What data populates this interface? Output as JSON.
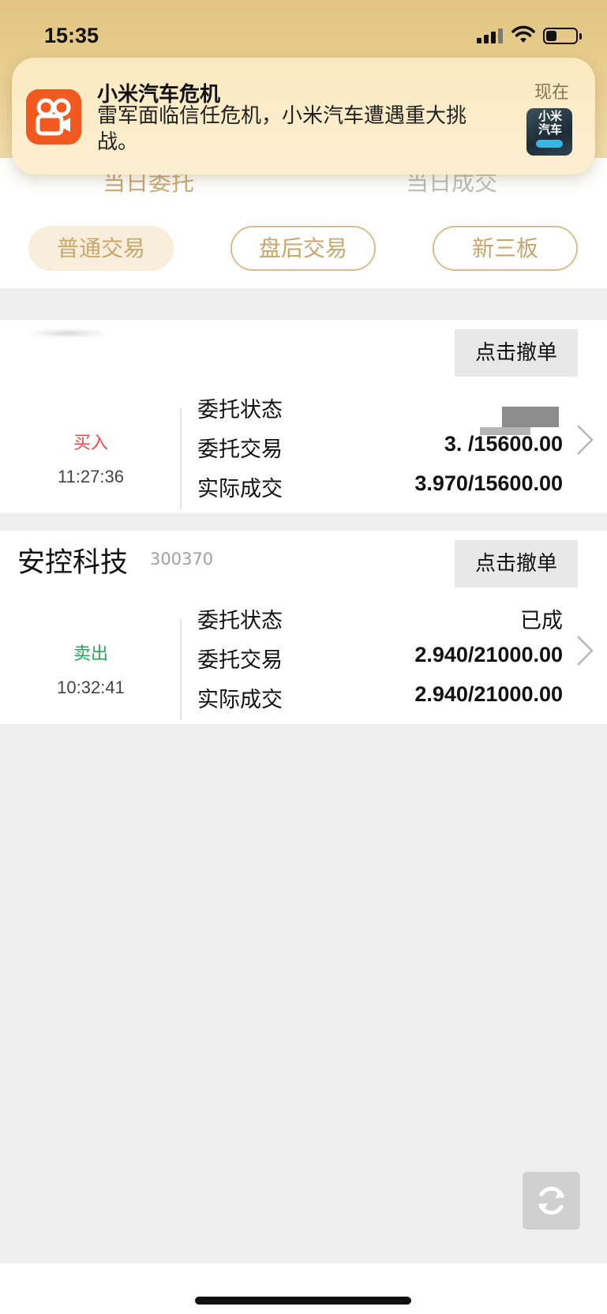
{
  "status_bar": {
    "time": "15:35",
    "battery_level": 0.35
  },
  "notification": {
    "app_icon": "kuaishou-app-icon",
    "title": "小米汽车危机",
    "body": "雷军面临信任危机，小米汽车遭遇重大挑战。",
    "time": "现在",
    "thumb_text": "小米\n汽车"
  },
  "tabs": {
    "entrusted": "当日委托",
    "deals": "当日成交"
  },
  "filters": [
    {
      "label": "普通交易",
      "active": true
    },
    {
      "label": "盘后交易",
      "active": false
    },
    {
      "label": "新三板",
      "active": false
    }
  ],
  "orders": [
    {
      "name": "",
      "code": "",
      "cancel_label": "点击撤单",
      "side": "买入",
      "time": "11:27:36",
      "status_label": "委托状态",
      "status_value": "",
      "entrust_label": "委托交易",
      "entrust_value": "3.  /15600.00",
      "actual_label": "实际成交",
      "actual_value": "3.970/15600.00"
    },
    {
      "name": "安控科技",
      "code": "300370",
      "cancel_label": "点击撤单",
      "side": "卖出",
      "time": "10:32:41",
      "status_label": "委托状态",
      "status_value": "已成",
      "entrust_label": "委托交易",
      "entrust_value": "2.940/21000.00",
      "actual_label": "实际成交",
      "actual_value": "2.940/21000.00"
    }
  ],
  "colors": {
    "header_gold": "#e2c47f",
    "pill_text": "#c9a66c",
    "buy": "#e34b4b",
    "sell": "#2aa45a"
  }
}
